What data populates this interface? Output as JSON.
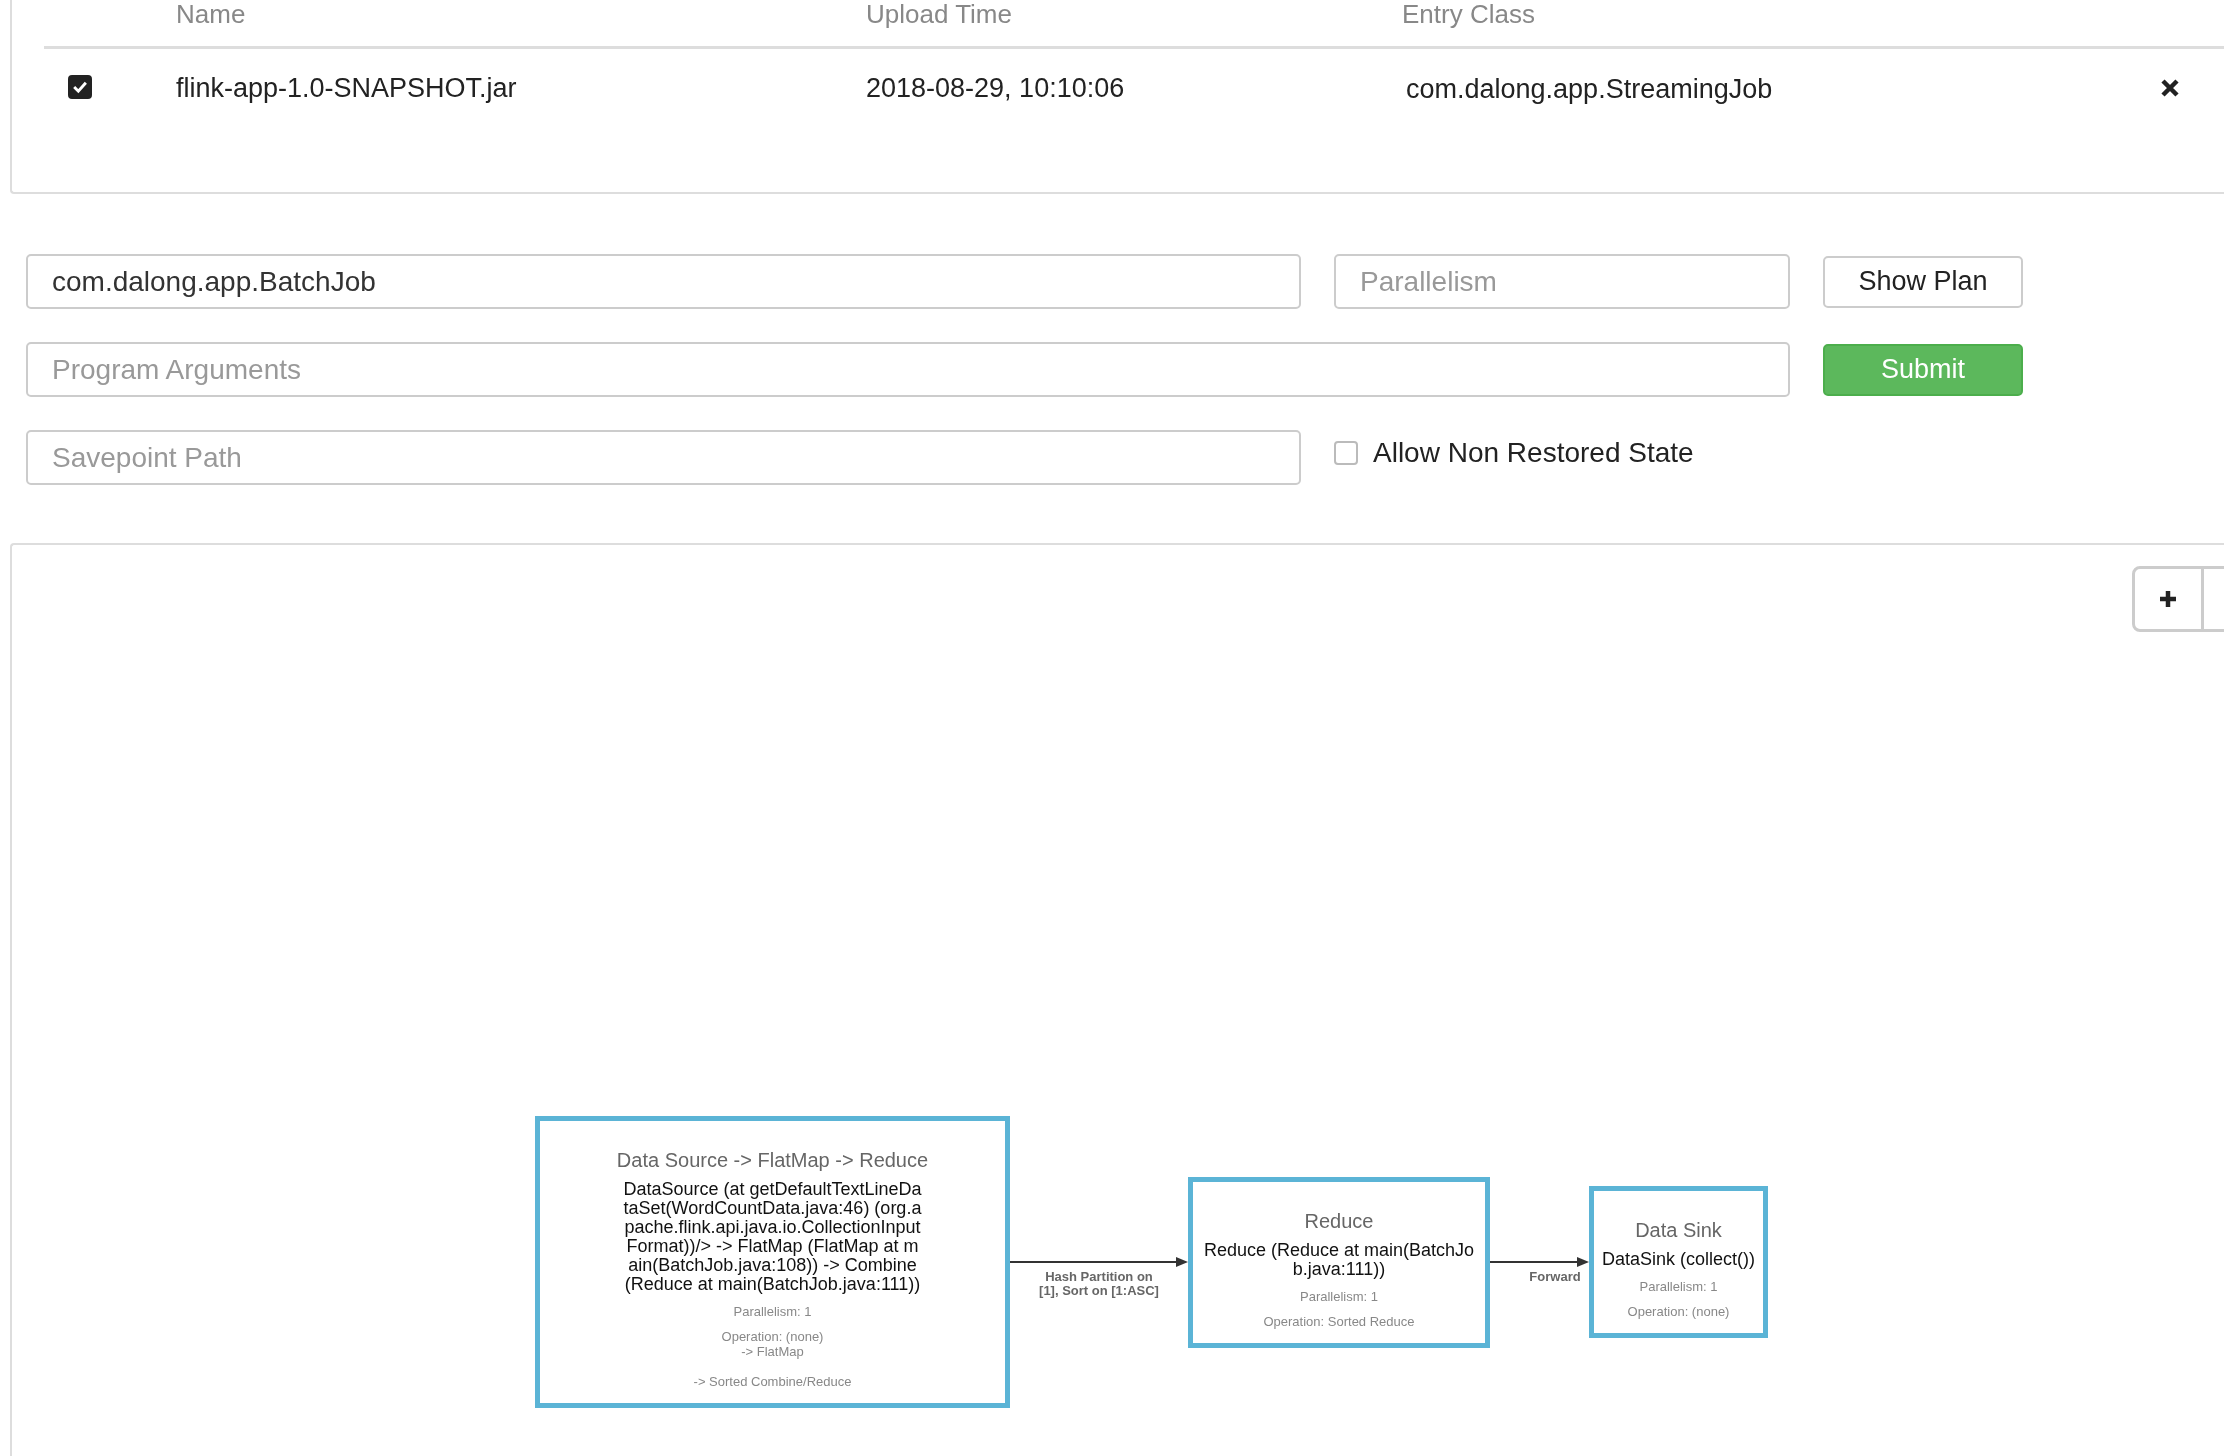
{
  "jars": {
    "columns": [
      "Name",
      "Upload Time",
      "Entry Class"
    ],
    "rows": [
      {
        "checked": true,
        "name": "flink-app-1.0-SNAPSHOT.jar",
        "upload_time": "2018-08-29, 10:10:06",
        "entry_class": "com.dalong.app.StreamingJob"
      }
    ]
  },
  "submit_form": {
    "entry_class": {
      "value": "com.dalong.app.BatchJob"
    },
    "parallelism": {
      "placeholder": "Parallelism"
    },
    "show_plan": "Show Plan",
    "program_arguments": {
      "placeholder": "Program Arguments"
    },
    "submit": "Submit",
    "savepoint_path": {
      "placeholder": "Savepoint Path"
    },
    "allow_non_restored_state": {
      "label": "Allow Non Restored State",
      "checked": false
    }
  },
  "plan": {
    "nodes": [
      {
        "title": "Data Source -> FlatMap -> Reduce",
        "description": "DataSource (at getDefaultTextLineDataSet(WordCountData.java:46) (org.apache.flink.api.java.io.CollectionInputFormat))/> -> FlatMap (FlatMap at main(BatchJob.java:108)) -> Combine (Reduce at main(BatchJob.java:111))",
        "parallelism": "Parallelism: 1",
        "operation": "Operation: (none)\n-> FlatMap\n\n-> Sorted Combine/Reduce"
      },
      {
        "title": "Reduce",
        "description": "Reduce (Reduce at main(BatchJob.java:111))",
        "parallelism": "Parallelism: 1",
        "operation": "Operation: Sorted Reduce"
      },
      {
        "title": "Data Sink",
        "description": "DataSink (collect())",
        "parallelism": "Parallelism: 1",
        "operation": "Operation: (none)"
      }
    ],
    "edges": [
      {
        "label": "Hash Partition on [1], Sort on [1:ASC]"
      },
      {
        "label": "Forward"
      }
    ]
  }
}
